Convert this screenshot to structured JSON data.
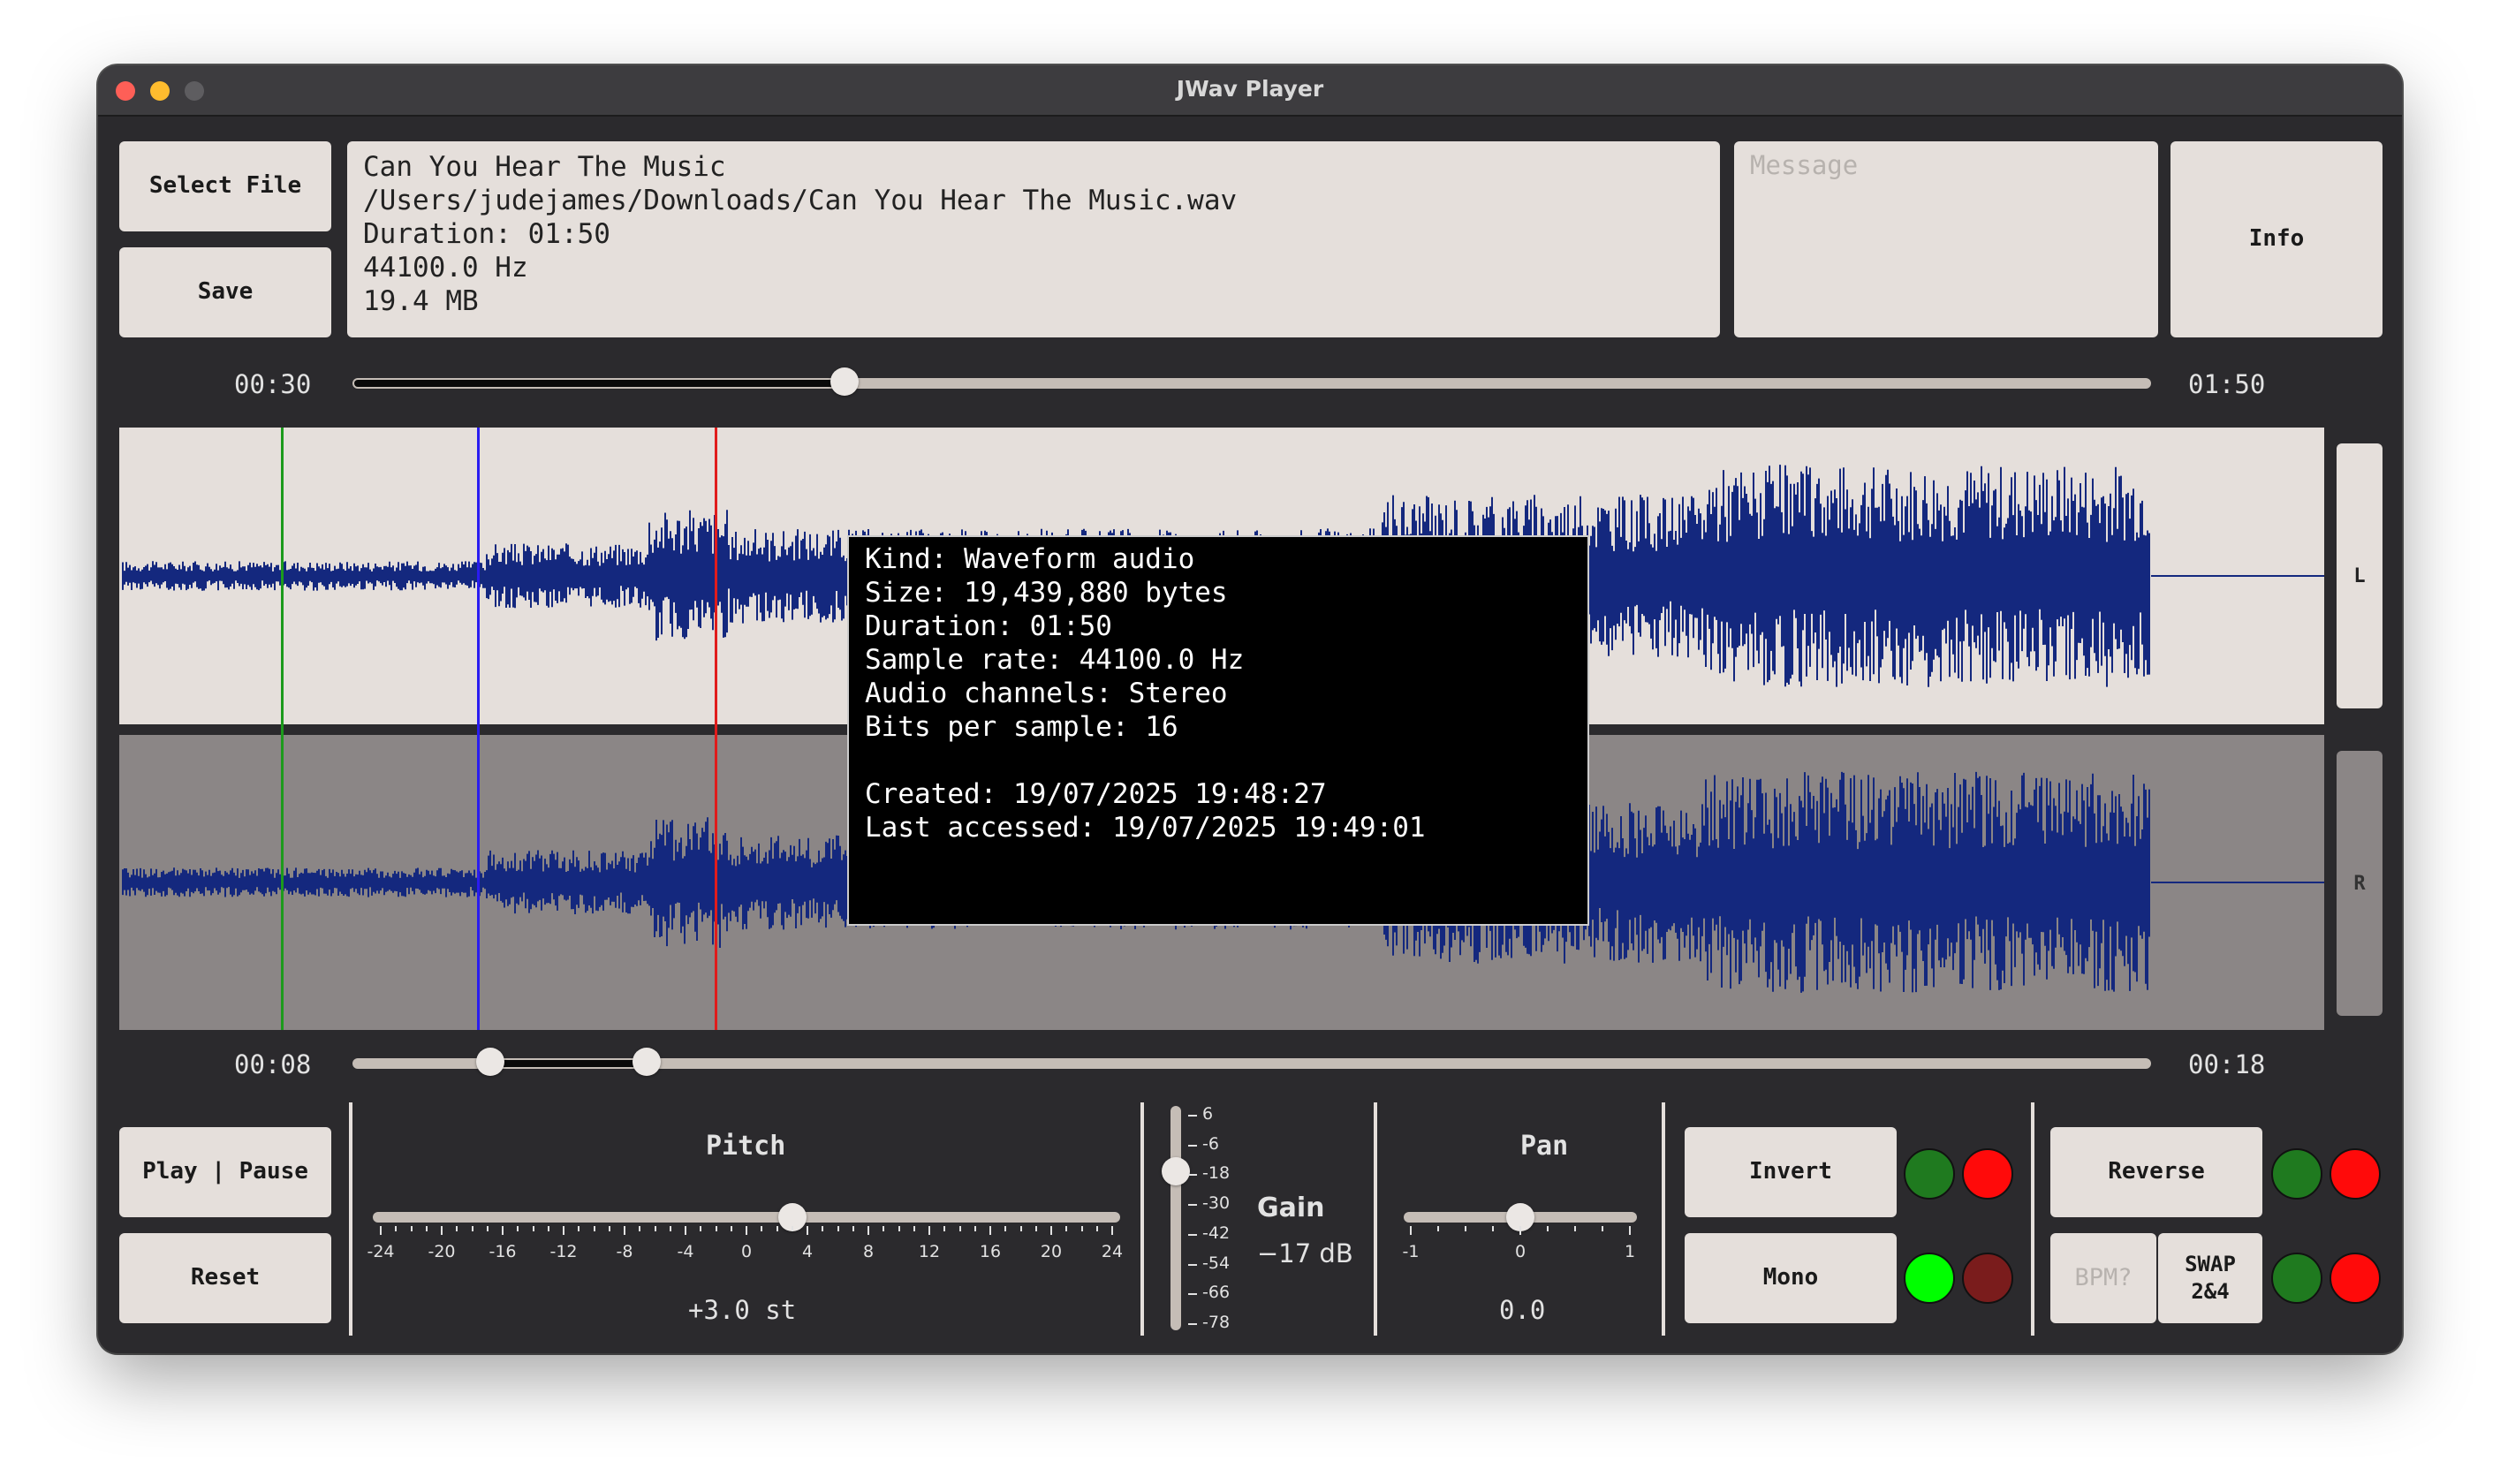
{
  "window": {
    "title": "JWav Player"
  },
  "top": {
    "select_file": "Select File",
    "save": "Save",
    "info": "Info",
    "message_placeholder": "Message",
    "file_info": [
      "Can You Hear The Music",
      "/Users/judejames/Downloads/Can You Hear The Music.wav",
      "Duration: 01:50",
      "44100.0 Hz",
      "19.4 MB"
    ]
  },
  "position": {
    "current": "00:30",
    "total": "01:50",
    "fraction": 0.273
  },
  "channels": {
    "left": "L",
    "right": "R"
  },
  "markers": {
    "colors": [
      "#1c9a1c",
      "#2a1cf0",
      "#e01c1c"
    ]
  },
  "tooltip": {
    "lines": [
      "Kind: Waveform audio",
      "Size: 19,439,880 bytes",
      "Duration: 01:50",
      "Sample rate: 44100.0 Hz",
      "Audio channels: Stereo",
      "Bits per sample: 16",
      "",
      "Created: 19/07/2025 19:48:27",
      "Last accessed: 19/07/2025 19:49:01"
    ]
  },
  "loop": {
    "start": "00:08",
    "end": "00:18",
    "start_fraction": 0.076,
    "end_fraction": 0.163
  },
  "controls": {
    "play_pause": "Play | Pause",
    "reset": "Reset",
    "pitch": {
      "label": "Pitch",
      "value": "+3.0 st",
      "ticks": [
        "-24",
        "-20",
        "-16",
        "-12",
        "-8",
        "-4",
        "0",
        "4",
        "8",
        "12",
        "16",
        "20",
        "24"
      ],
      "fraction": 0.5625
    },
    "gain": {
      "label": "Gain",
      "value": "−17 dB",
      "ticks": [
        "6",
        "-6",
        "-18",
        "-30",
        "-42",
        "-54",
        "-66",
        "-78"
      ]
    },
    "pan": {
      "label": "Pan",
      "value": "0.0",
      "ticks": [
        "-1",
        "0",
        "1"
      ],
      "fraction": 0.5
    },
    "invert": "Invert",
    "mono": "Mono",
    "reverse": "Reverse",
    "bpm_placeholder": "BPM?",
    "swap_line1": "SWAP",
    "swap_line2": "2&4"
  },
  "leds": {
    "invert": [
      "#1f7a1f",
      "#ff0a0a"
    ],
    "mono": [
      "#00ff00",
      "#7a1c1c"
    ],
    "reverse": [
      "#1f7a1f",
      "#ff0a0a"
    ],
    "swap": [
      "#1f7a1f",
      "#ff0a0a"
    ]
  },
  "waveform_color": "#14287e"
}
